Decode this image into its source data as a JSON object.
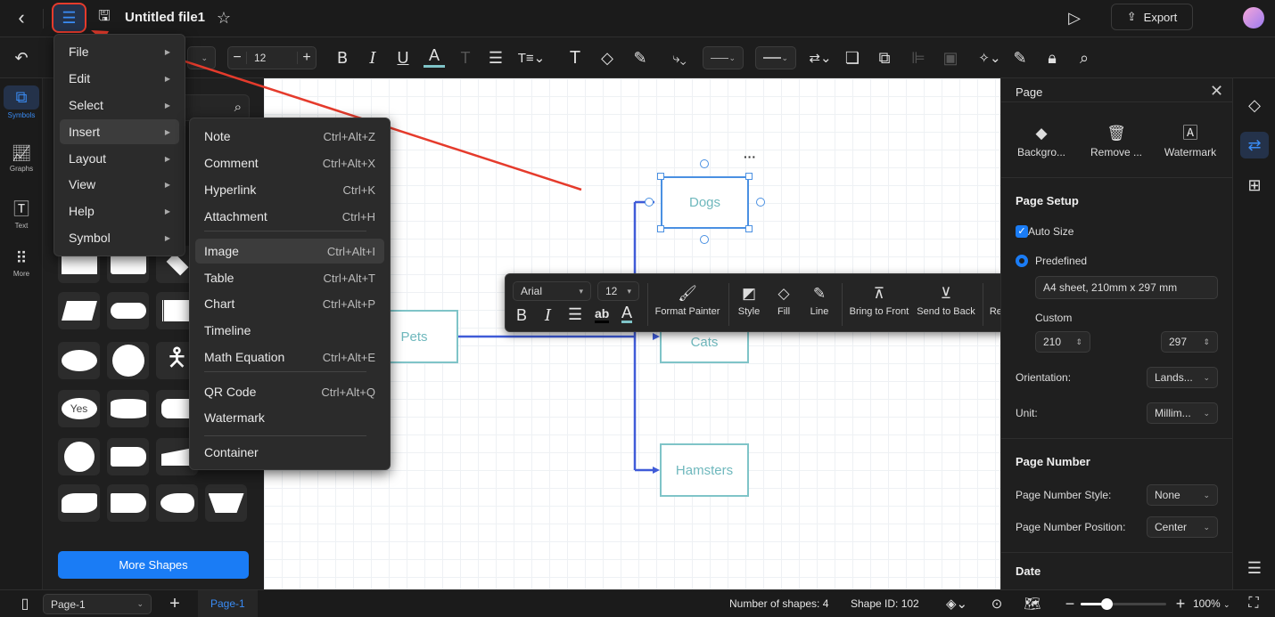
{
  "header": {
    "title": "Untitled file1",
    "export_label": "Export"
  },
  "toolbar": {
    "font_size": "12"
  },
  "sidebar": {
    "items": [
      {
        "label": "Symbols",
        "icon": "symbols-icon"
      },
      {
        "label": "Graphs",
        "icon": "graphs-icon"
      },
      {
        "label": "Text",
        "icon": "text-icon"
      },
      {
        "label": "More",
        "icon": "more-icon"
      }
    ],
    "more_shapes_label": "More Shapes",
    "tile_yes": "Yes"
  },
  "main_menu": {
    "items": [
      {
        "label": "File"
      },
      {
        "label": "Edit"
      },
      {
        "label": "Select"
      },
      {
        "label": "Insert"
      },
      {
        "label": "Layout"
      },
      {
        "label": "View"
      },
      {
        "label": "Help"
      },
      {
        "label": "Symbol"
      }
    ]
  },
  "insert_menu": {
    "items": [
      {
        "label": "Note",
        "shortcut": "Ctrl+Alt+Z"
      },
      {
        "label": "Comment",
        "shortcut": "Ctrl+Alt+X"
      },
      {
        "label": "Hyperlink",
        "shortcut": "Ctrl+K"
      },
      {
        "label": "Attachment",
        "shortcut": "Ctrl+H"
      },
      {
        "label": "Image",
        "shortcut": "Ctrl+Alt+I"
      },
      {
        "label": "Table",
        "shortcut": "Ctrl+Alt+T"
      },
      {
        "label": "Chart",
        "shortcut": "Ctrl+Alt+P"
      },
      {
        "label": "Timeline",
        "shortcut": ""
      },
      {
        "label": "Math Equation",
        "shortcut": "Ctrl+Alt+E"
      },
      {
        "label": "QR Code",
        "shortcut": "Ctrl+Alt+Q"
      },
      {
        "label": "Watermark",
        "shortcut": ""
      },
      {
        "label": "Container",
        "shortcut": ""
      }
    ]
  },
  "canvas": {
    "nodes": {
      "pets": "Pets",
      "dogs": "Dogs",
      "cats": "Cats",
      "hamsters": "Hamsters"
    },
    "more": "···"
  },
  "float_toolbar": {
    "font": "Arial",
    "size": "12",
    "bold": "B",
    "italic": "I",
    "ab": "ab",
    "a": "A",
    "format_painter": "Format Painter",
    "style": "Style",
    "fill": "Fill",
    "line": "Line",
    "bring_front": "Bring to Front",
    "send_back": "Send to Back",
    "replace": "Replace"
  },
  "right_panel": {
    "title": "Page",
    "actions": [
      {
        "label": "Backgro..."
      },
      {
        "label": "Remove ..."
      },
      {
        "label": "Watermark"
      }
    ],
    "page_setup": "Page Setup",
    "auto_size": "Auto Size",
    "auto_size_checked": true,
    "predefined": "Predefined",
    "paper": "A4 sheet, 210mm x 297 mm",
    "custom": "Custom",
    "width": "210",
    "height": "297",
    "orientation_label": "Orientation:",
    "orientation": "Lands...",
    "unit_label": "Unit:",
    "unit": "Millim...",
    "page_number": "Page Number",
    "pn_style_label": "Page Number Style:",
    "pn_style": "None",
    "pn_pos_label": "Page Number Position:",
    "pn_pos": "Center",
    "date": "Date"
  },
  "status": {
    "page_select": "Page-1",
    "page_tab": "Page-1",
    "shapes": "Number of shapes: 4",
    "shape_id": "Shape ID: 102",
    "zoom": "100%",
    "zoom_fraction": 0.3
  },
  "colors": {
    "accent": "#1a7cf5",
    "annotation": "#e53b2c",
    "node_border": "#7fc4c8",
    "connector": "#3f5bd8"
  }
}
